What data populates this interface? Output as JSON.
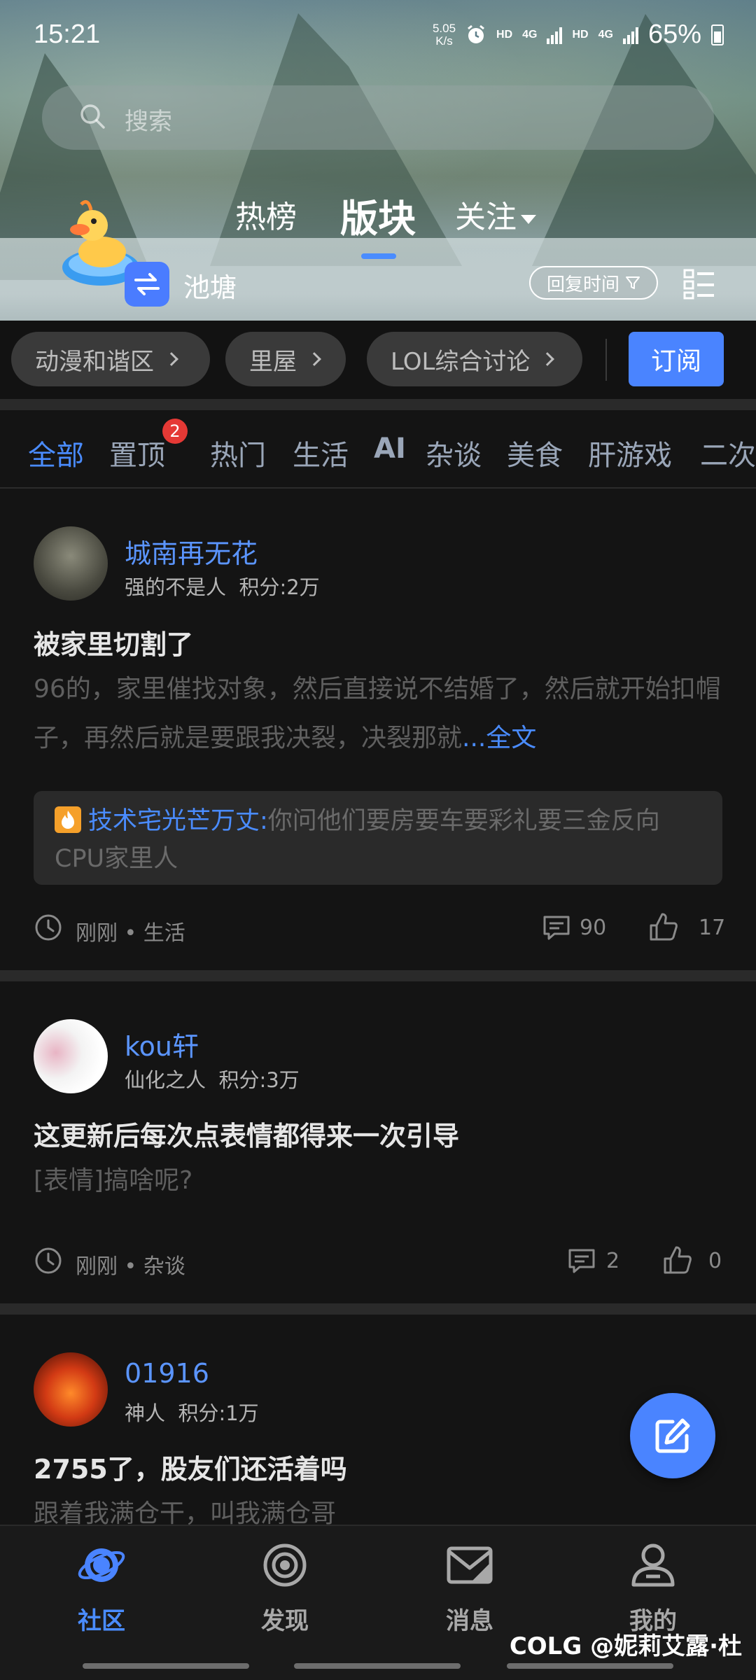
{
  "status_bar": {
    "time": "15:21",
    "net_speed": "5.05",
    "net_unit": "K/s",
    "hd1": "HD",
    "net1": "4G",
    "hd2": "HD",
    "net2": "4G",
    "battery": "65%"
  },
  "search": {
    "placeholder": "搜索"
  },
  "top_tabs": [
    {
      "label": "热榜",
      "active": false
    },
    {
      "label": "版块",
      "active": true
    },
    {
      "label": "关注",
      "active": false
    }
  ],
  "pond": {
    "label": "池塘"
  },
  "sort_button": {
    "label": "回复时间"
  },
  "boards": [
    {
      "label": "动漫和谐区"
    },
    {
      "label": "里屋"
    },
    {
      "label": "LOL综合讨论"
    }
  ],
  "subscribe": {
    "label": "订阅"
  },
  "categories": [
    {
      "label": "全部",
      "active": true
    },
    {
      "label": "置顶"
    },
    {
      "label": "热门"
    },
    {
      "label": "生活"
    },
    {
      "label": "AI"
    },
    {
      "label": "杂谈"
    },
    {
      "label": "美食"
    },
    {
      "label": "肝游戏"
    },
    {
      "label": "二次"
    }
  ],
  "pinned_badge": "2",
  "posts": [
    {
      "author": "城南再无花",
      "rank": "强的不是人",
      "points": "积分:2万",
      "title": "被家里切割了",
      "body": "96的，家里催找对象，然后直接说不结婚了，然后就开始扣帽子，再然后就是要跟我决裂，决裂那就",
      "more": "...全文",
      "quote_author": "技术宅光芒万丈:",
      "quote_text": "你问他们要房要车要彩礼要三金反向CPU家里人",
      "time_tag": "刚刚 • 生活",
      "comments": "90",
      "likes": "17"
    },
    {
      "author": "kou轩",
      "rank": "仙化之人",
      "points": "积分:3万",
      "title": "这更新后每次点表情都得来一次引导",
      "body": "[表情]搞啥呢?",
      "time_tag": "刚刚 • 杂谈",
      "comments": "2",
      "likes": "0"
    },
    {
      "author": "01916",
      "rank": "神人",
      "points": "积分:1万",
      "title": "2755了，股友们还活着吗",
      "body": "跟着我满仓干，叫我满仓哥"
    }
  ],
  "bottom_nav": [
    {
      "label": "社区",
      "icon": "planet-icon",
      "active": true
    },
    {
      "label": "发现",
      "icon": "discover-icon"
    },
    {
      "label": "消息",
      "icon": "mail-icon"
    },
    {
      "label": "我的",
      "icon": "profile-icon"
    }
  ],
  "watermark": "COLG @妮莉艾露·杜",
  "colors": {
    "accent": "#4a84ff",
    "background": "#141414",
    "badge_red": "#e53935"
  }
}
